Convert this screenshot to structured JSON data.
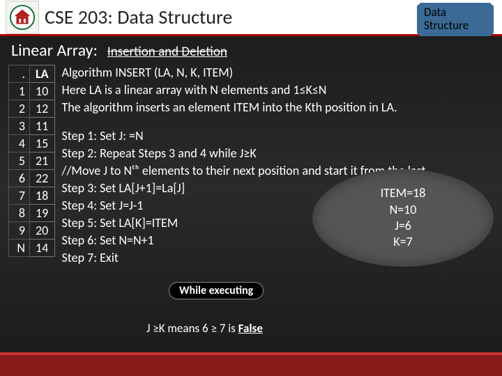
{
  "header": {
    "title": "CSE 203: Data Structure",
    "badge_line1": "Data",
    "badge_line2": "Structure"
  },
  "subhead": {
    "label": "Linear Array:",
    "topic": "Insertion and Deletion"
  },
  "table": {
    "col_header_blank": ".",
    "col_header_la": "LA",
    "rows": [
      {
        "i": "1",
        "v": "10"
      },
      {
        "i": "2",
        "v": "12"
      },
      {
        "i": "3",
        "v": "11"
      },
      {
        "i": "4",
        "v": "15"
      },
      {
        "i": "5",
        "v": "21"
      },
      {
        "i": "6",
        "v": "22"
      },
      {
        "i": "7",
        "v": "18"
      },
      {
        "i": "8",
        "v": "19"
      },
      {
        "i": "9",
        "v": "20"
      }
    ],
    "n_label": "N",
    "n_value": "14"
  },
  "algo": {
    "line1": "Algorithm INSERT (LA, N, K, ITEM)",
    "line2": "Here LA is a linear array with N elements and 1≤K≤N",
    "line3": "The algorithm inserts an element ITEM into the Kth position in LA.",
    "s1": "Step 1: Set J: =N",
    "s2": "Step 2: Repeat Steps 3 and 4 while J≥K",
    "s2b": "//Move J to Nᵗʰ elements to their next position and start  it from the last",
    "s3": "Step 3: Set LA[J+1]=La[J]",
    "s4": "Step 4: Set J=J-1",
    "s5": "Step 5: Set LA[K]=ITEM",
    "s6": "Step 6: Set N=N+1",
    "s7": "Step 7: Exit"
  },
  "bubble": {
    "item": "ITEM=18",
    "n": "N=10",
    "j": "J=6",
    "k": "K=7"
  },
  "exec_label": "While executing",
  "footnote_pre": "J ≥K means 6 ≥ 7 is ",
  "footnote_val": "False"
}
